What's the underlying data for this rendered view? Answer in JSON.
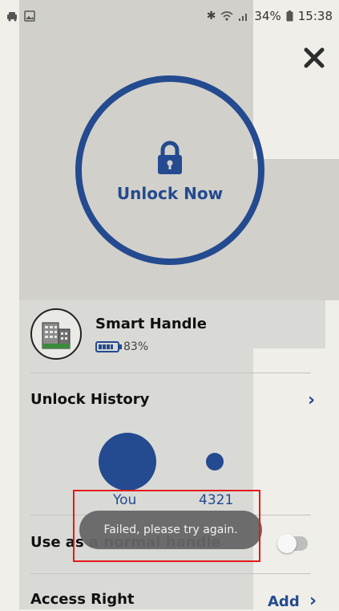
{
  "status_bar": {
    "left_icons": [
      "car-notification-icon",
      "image-notification-icon"
    ],
    "right_icons": [
      "bluetooth-icon",
      "wifi-icon",
      "signal-icon",
      "battery-icon"
    ],
    "battery_percent": "34%",
    "time": "15:38"
  },
  "unlock": {
    "label": "Unlock Now"
  },
  "device": {
    "name": "Smart Handle",
    "battery": "83%",
    "battery_level": 0.83
  },
  "unlock_history": {
    "title": "Unlock History",
    "users": [
      {
        "label": "You"
      },
      {
        "label": "4321"
      }
    ]
  },
  "normal_handle": {
    "label": "Use as a normal handle",
    "enabled": false
  },
  "access_right": {
    "title": "Access Right",
    "add_label": "Add"
  },
  "toast": {
    "message": "Failed, please try again."
  },
  "colors": {
    "accent": "#244a8f",
    "highlight": "#e01b1b"
  }
}
